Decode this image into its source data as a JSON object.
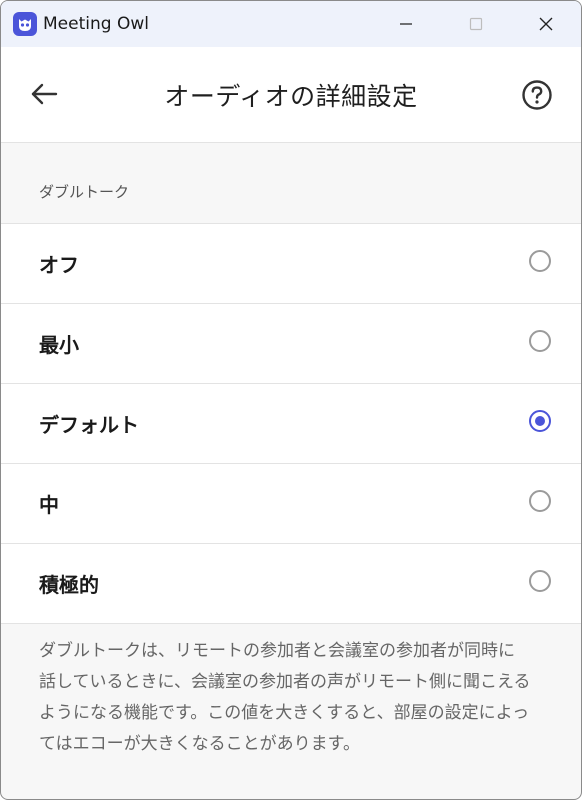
{
  "window": {
    "title": "Meeting Owl",
    "icon": "owl-icon",
    "controls": [
      "minimize-icon",
      "maximize-icon",
      "close-icon"
    ]
  },
  "header": {
    "title": "オーディオの詳細設定",
    "back_icon": "arrow-left-icon",
    "help_icon": "question-circle-icon"
  },
  "section": {
    "title": "ダブルトーク"
  },
  "options": [
    {
      "label": "オフ",
      "selected": false
    },
    {
      "label": "最小",
      "selected": false
    },
    {
      "label": "デフォルト",
      "selected": true
    },
    {
      "label": "中",
      "selected": false
    },
    {
      "label": "積極的",
      "selected": false
    }
  ],
  "description": "ダブルトークは、リモートの参加者と会議室の参加者が同時に話しているときに、会議室の参加者の声がリモート側に聞こえるようになる機能です。この値を大きくすると、部屋の設定によってはエコーが大きくなることがあります。",
  "colors": {
    "accent": "#4b55d9",
    "titlebar": "#eef2fb"
  }
}
